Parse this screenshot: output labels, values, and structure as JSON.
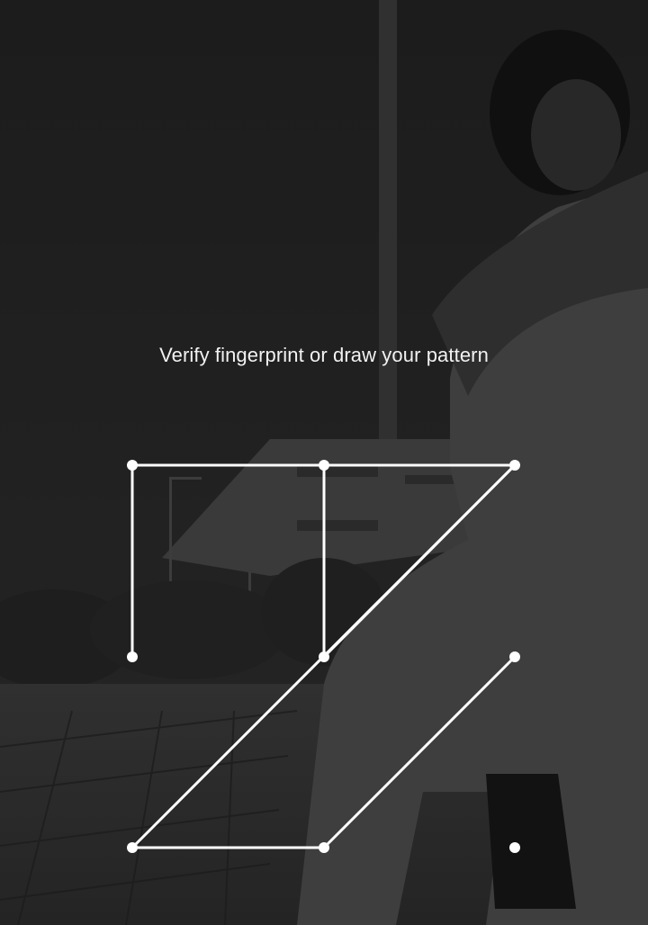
{
  "lockscreen": {
    "prompt": "Verify fingerprint or draw your pattern"
  },
  "pattern": {
    "grid": [
      3,
      3
    ],
    "path": [
      4,
      1,
      3,
      5,
      2,
      3,
      7,
      8,
      6
    ],
    "dot_color": "#ffffff",
    "line_color": "#ffffff"
  },
  "theme": {
    "overlay": "#1b1b1b"
  }
}
